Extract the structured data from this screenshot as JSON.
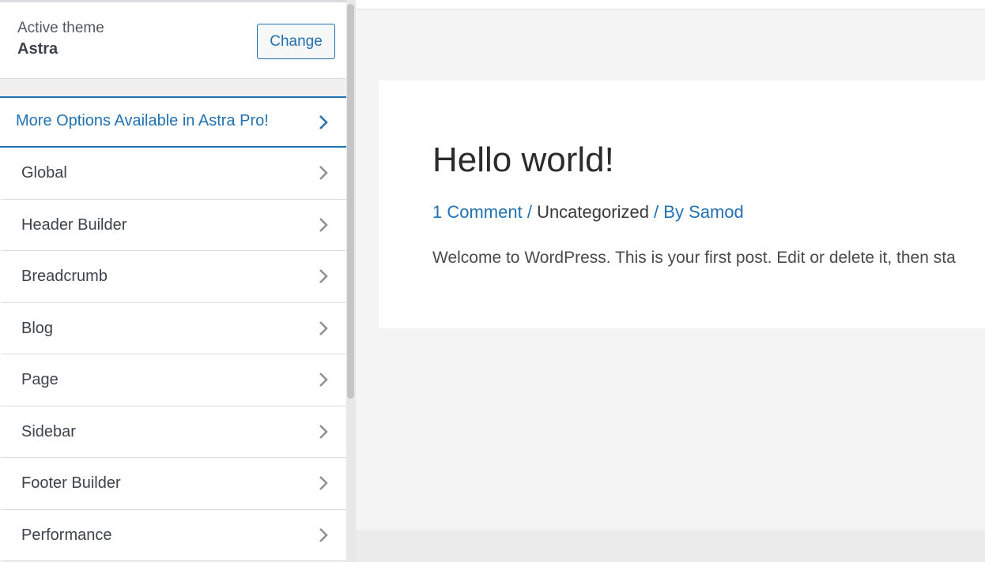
{
  "theme": {
    "label": "Active theme",
    "name": "Astra",
    "change_label": "Change"
  },
  "pro_item": {
    "label": "More Options Available in Astra Pro!"
  },
  "menu": {
    "items": [
      {
        "label": "Global"
      },
      {
        "label": "Header Builder"
      },
      {
        "label": "Breadcrumb"
      },
      {
        "label": "Blog"
      },
      {
        "label": "Page"
      },
      {
        "label": "Sidebar"
      },
      {
        "label": "Footer Builder"
      },
      {
        "label": "Performance"
      }
    ]
  },
  "post": {
    "title": "Hello world!",
    "comments_link": "1 Comment",
    "sep1": " / ",
    "category": "Uncategorized",
    "sep2": " / By ",
    "author": "Samod",
    "excerpt": "Welcome to WordPress. This is your first post. Edit or delete it, then sta"
  },
  "colors": {
    "accent": "#2271b1",
    "panel_bg": "#f0f0f1"
  }
}
